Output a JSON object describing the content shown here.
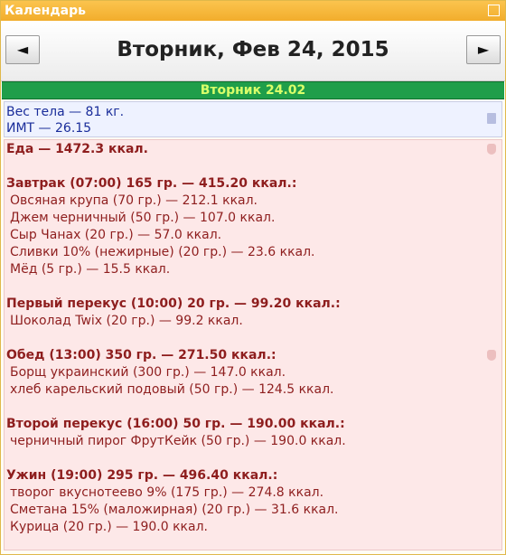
{
  "window": {
    "title": "Календарь"
  },
  "navigation": {
    "prev_label": "◄",
    "next_label": "►",
    "date_title": "Вторник, Фев 24, 2015"
  },
  "day_header": "Вторник 24.02",
  "body_stats": {
    "weight": "Вес тела — 81 кг.",
    "bmi": "ИМТ — 26.15"
  },
  "food": {
    "total": "Еда — 1472.3 ккал.",
    "meals": [
      {
        "heading": "Завтрак (07:00) 165 гр. — 415.20 ккал.:",
        "items": [
          "Овсяная крупа (70 гр.) — 212.1 ккал.",
          "Джем черничный (50 гр.) — 107.0 ккал.",
          "Сыр Чанах (20 гр.) — 57.0 ккал.",
          "Сливки 10% (нежирные) (20 гр.) — 23.6 ккал.",
          "Мёд (5 гр.) — 15.5 ккал."
        ]
      },
      {
        "heading": "Первый перекус (10:00) 20 гр. — 99.20 ккал.:",
        "items": [
          "Шоколад Twix (20 гр.) — 99.2 ккал."
        ]
      },
      {
        "heading": "Обед (13:00) 350 гр. — 271.50 ккал.:",
        "items": [
          "Борщ украинский (300 гр.) — 147.0 ккал.",
          "хлеб карельский подовый (50 гр.) — 124.5 ккал."
        ]
      },
      {
        "heading": "Второй перекус (16:00) 50 гр. — 190.00 ккал.:",
        "items": [
          "черничный пирог ФрутКейк (50 гр.) — 190.0 ккал."
        ]
      },
      {
        "heading": "Ужин (19:00) 295 гр. — 496.40 ккал.:",
        "items": [
          "творог вкуснотеево 9% (175 гр.) — 274.8 ккал.",
          "Сметана 15% (маложирная) (20 гр.) — 31.6 ккал.",
          "Курица (20 гр.) — 190.0 ккал."
        ]
      }
    ]
  }
}
